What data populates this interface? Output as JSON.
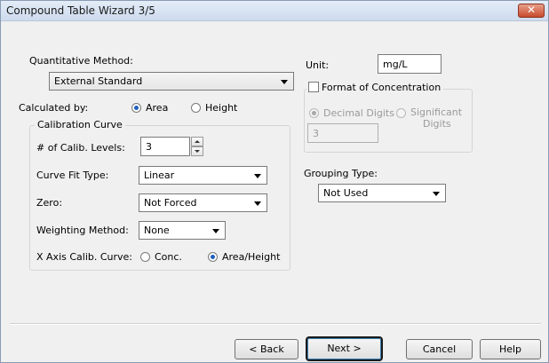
{
  "window": {
    "title": "Compound Table Wizard 3/5"
  },
  "quantitative_method": {
    "label": "Quantitative Method:",
    "value": "External Standard"
  },
  "calculated_by": {
    "label": "Calculated by:",
    "options": [
      "Area",
      "Height"
    ],
    "selected": "Area"
  },
  "calibration_curve": {
    "group_title": "Calibration Curve",
    "levels_label": "# of Calib. Levels:",
    "levels_value": "3",
    "fit_type_label": "Curve Fit Type:",
    "fit_type_value": "Linear",
    "zero_label": "Zero:",
    "zero_value": "Not Forced",
    "weighting_label": "Weighting Method:",
    "weighting_value": "None",
    "x_axis_label": "X Axis Calib. Curve:",
    "x_axis_options": [
      "Conc.",
      "Area/Height"
    ],
    "x_axis_selected": "Area/Height"
  },
  "unit": {
    "label": "Unit:",
    "value": "mg/L"
  },
  "format_of_concentration": {
    "label": "Format of Concentration",
    "checked": false,
    "decimal_label": "Decimal Digits",
    "significant_label_line1": "Significant",
    "significant_label_line2": "Digits",
    "selected": "Decimal Digits",
    "digits_value": "3"
  },
  "grouping_type": {
    "label": "Grouping Type:",
    "value": "Not Used"
  },
  "buttons": {
    "back": "< Back",
    "next": "Next >",
    "cancel": "Cancel",
    "help": "Help"
  },
  "icons": {
    "close": "close-icon"
  }
}
